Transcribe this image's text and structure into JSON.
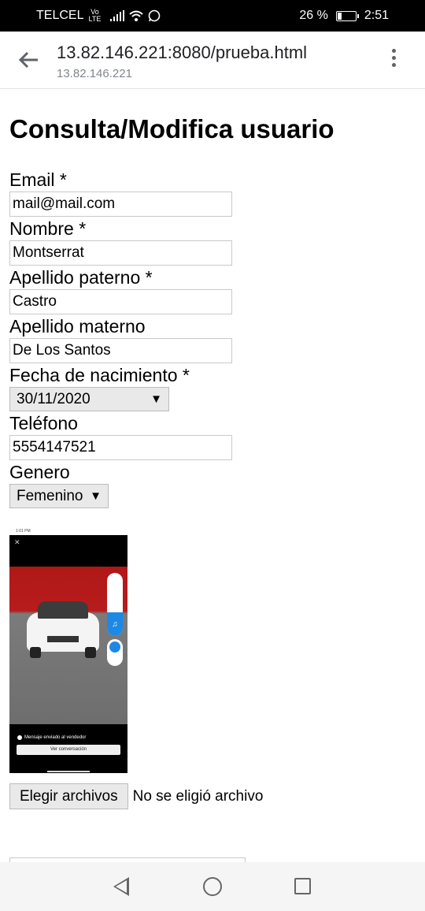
{
  "status_bar": {
    "carrier": "TELCEL",
    "volte": "Vo LTE",
    "battery_percent": "26 %",
    "battery_level": 0.26,
    "time": "2:51",
    "icons": [
      "signal-icon",
      "wifi-icon",
      "whatsapp-icon",
      "battery-icon"
    ]
  },
  "browser": {
    "url": "13.82.146.221:8080/prueba.html",
    "host": "13.82.146.221",
    "back_icon": "back-arrow-icon",
    "menu_icon": "more-vert-icon"
  },
  "page": {
    "title": "Consulta/Modifica usuario",
    "fields": {
      "email": {
        "label": "Email *",
        "value": "mail@mail.com"
      },
      "nombre": {
        "label": "Nombre *",
        "value": "Montserrat"
      },
      "apellido_paterno": {
        "label": "Apellido paterno *",
        "value": "Castro"
      },
      "apellido_materno": {
        "label": "Apellido materno",
        "value": "De Los Santos"
      },
      "fecha": {
        "label": "Fecha de nacimiento *",
        "value": "30/11/2020"
      },
      "telefono": {
        "label": "Teléfono",
        "value": "5554147521"
      },
      "genero": {
        "label": "Genero",
        "value": "Femenino"
      }
    },
    "image_preview": {
      "status_text": "1:01 PM",
      "message": "Mensaje enviado al vendedor",
      "button": "Ver conversación"
    },
    "file_input": {
      "button_label": "Elegir archivos",
      "status": "No se eligió archivo"
    }
  },
  "nav_bar": {
    "icons": [
      "nav-back-icon",
      "nav-home-icon",
      "nav-recents-icon"
    ]
  }
}
